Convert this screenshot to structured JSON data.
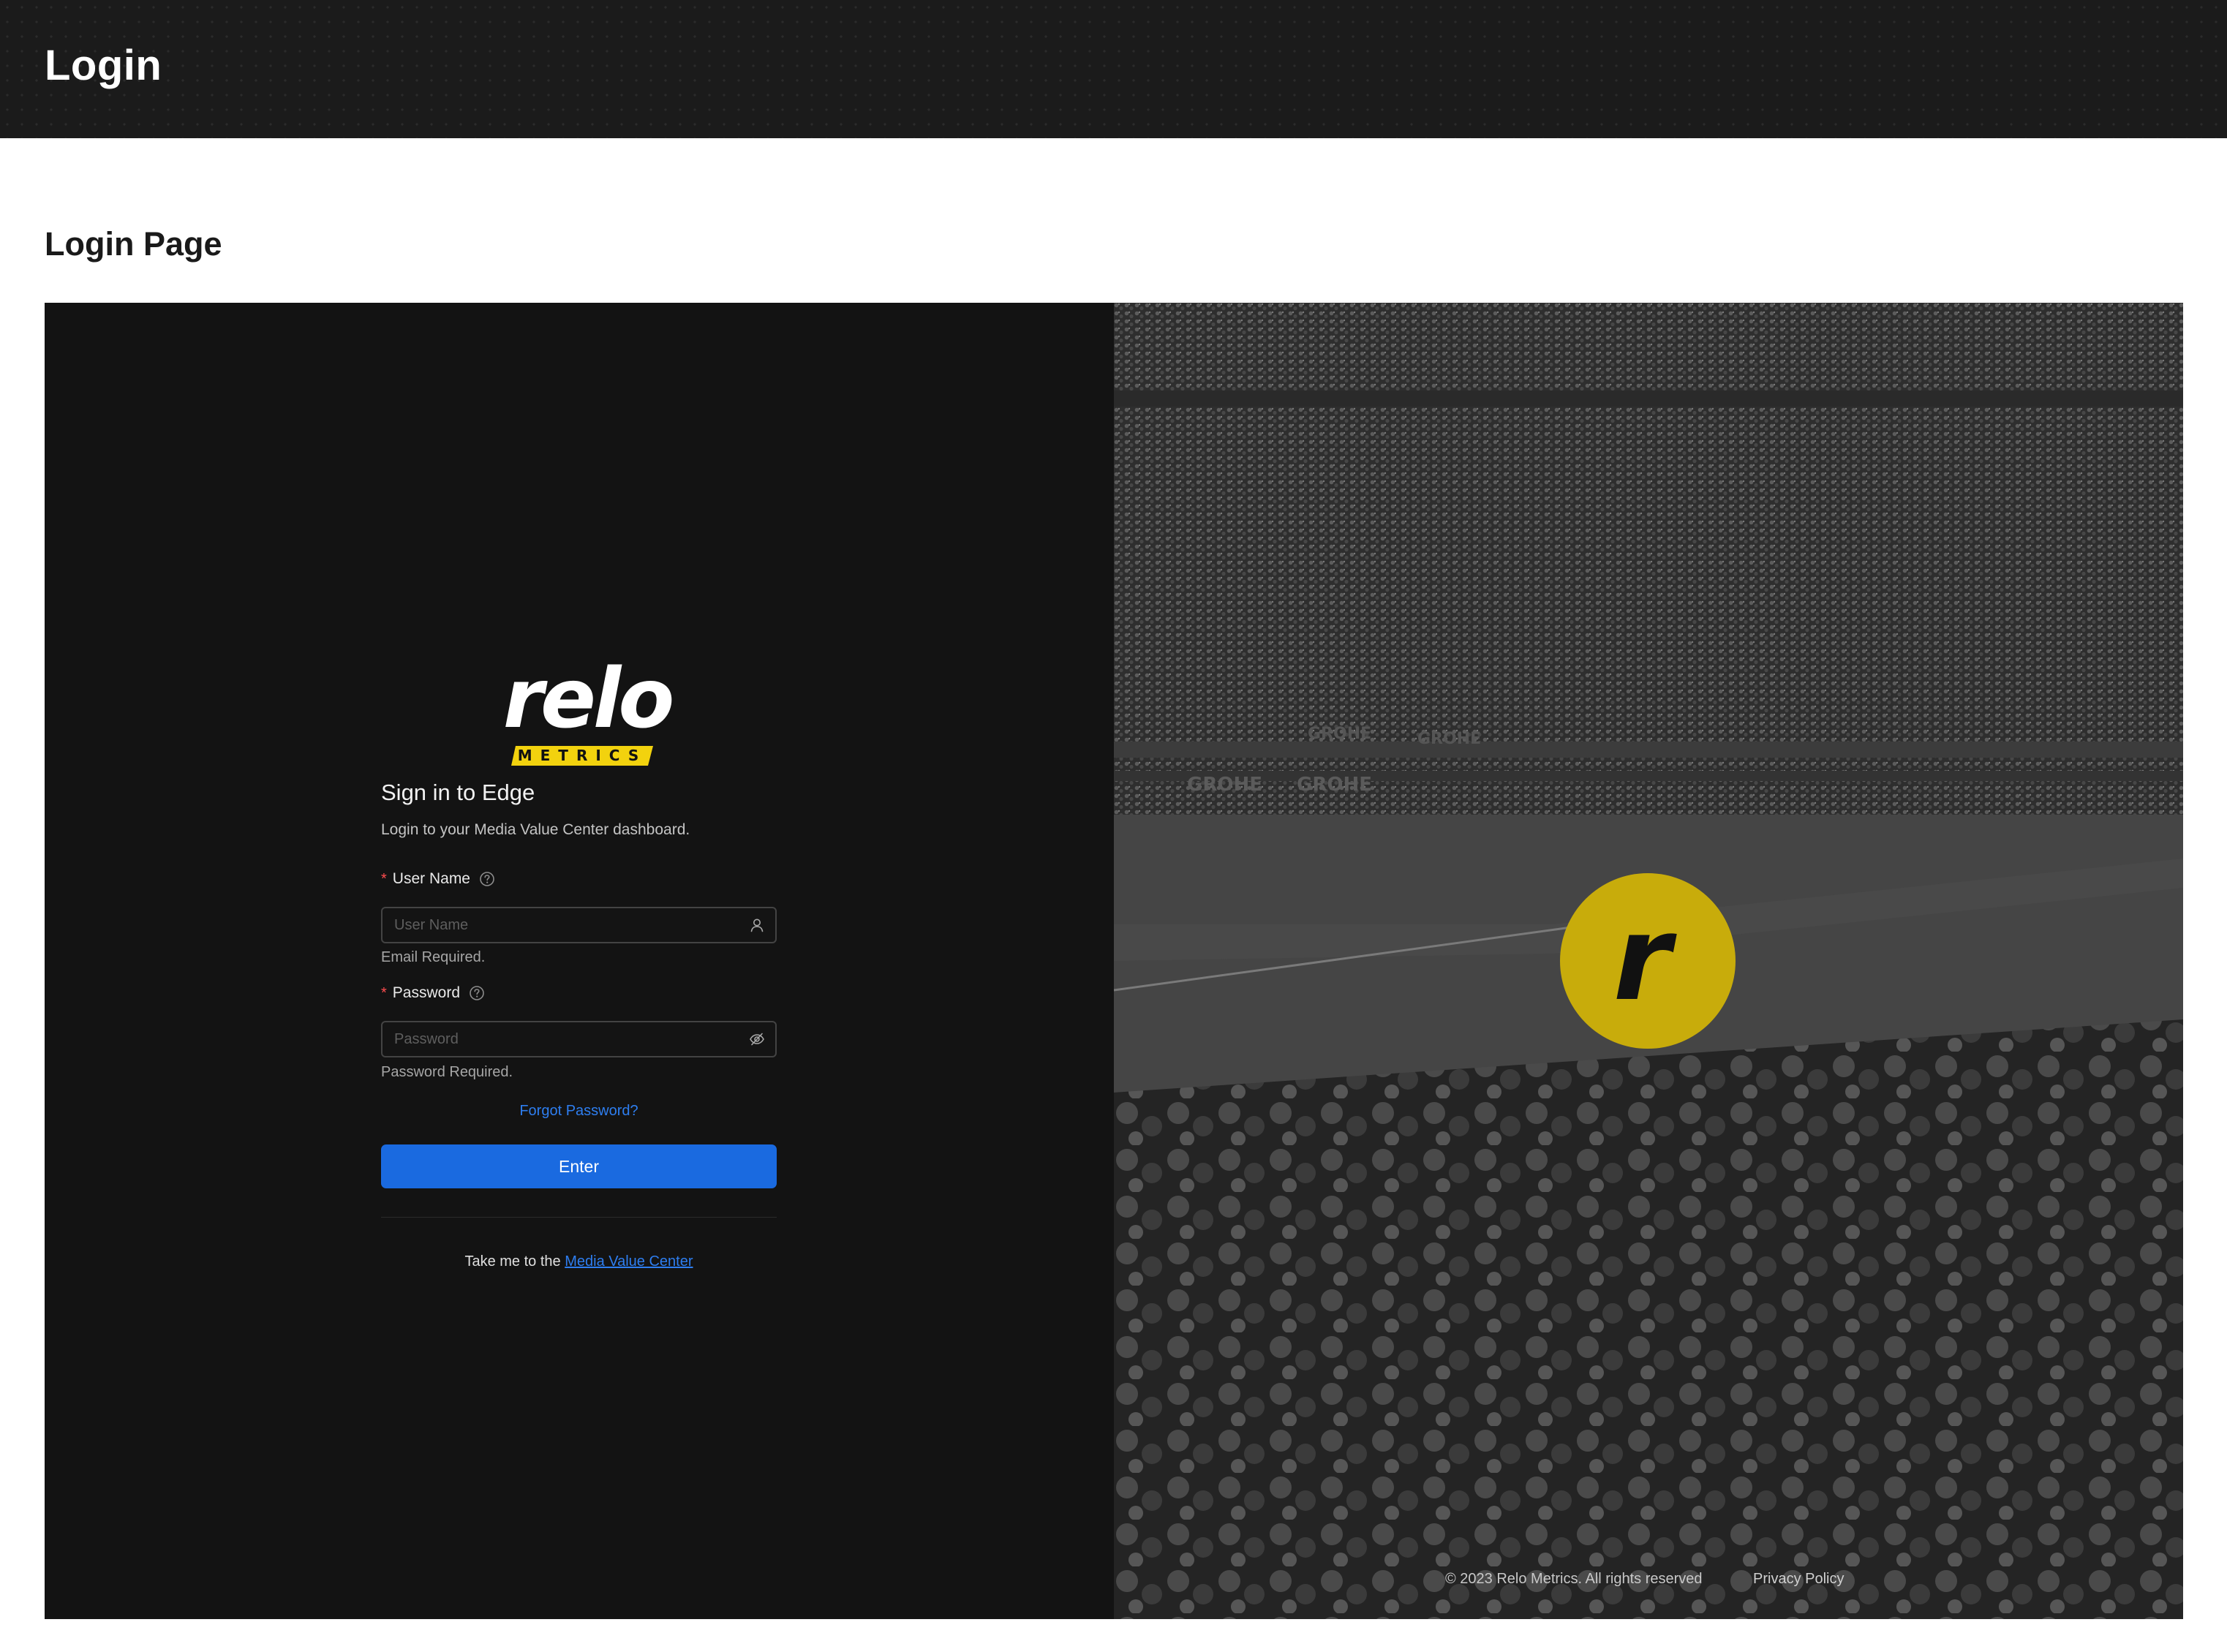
{
  "header": {
    "title": "Login"
  },
  "page": {
    "heading": "Login Page"
  },
  "brand": {
    "logo_word": "relo",
    "logo_tag": "METRICS",
    "badge_letter": "r",
    "accent_color": "#f2d20e"
  },
  "form": {
    "title": "Sign in to Edge",
    "subtitle": "Login to your Media Value Center dashboard.",
    "username": {
      "label": "User Name",
      "placeholder": "User Name",
      "value": "",
      "error": "Email Required."
    },
    "password": {
      "label": "Password",
      "placeholder": "Password",
      "value": "",
      "error": "Password Required."
    },
    "required_mark": "*",
    "forgot_link": "Forgot Password?",
    "submit_label": "Enter",
    "bottom_text": "Take me to the",
    "bottom_link": "Media Value Center"
  },
  "footer": {
    "copyright": "© 2023 Relo Metrics. All rights reserved",
    "privacy": "Privacy Policy"
  },
  "colors": {
    "primary": "#1a6ae0",
    "link": "#2e7ef0",
    "panel_bg": "#131313",
    "error_mark": "#ff4d4f"
  }
}
